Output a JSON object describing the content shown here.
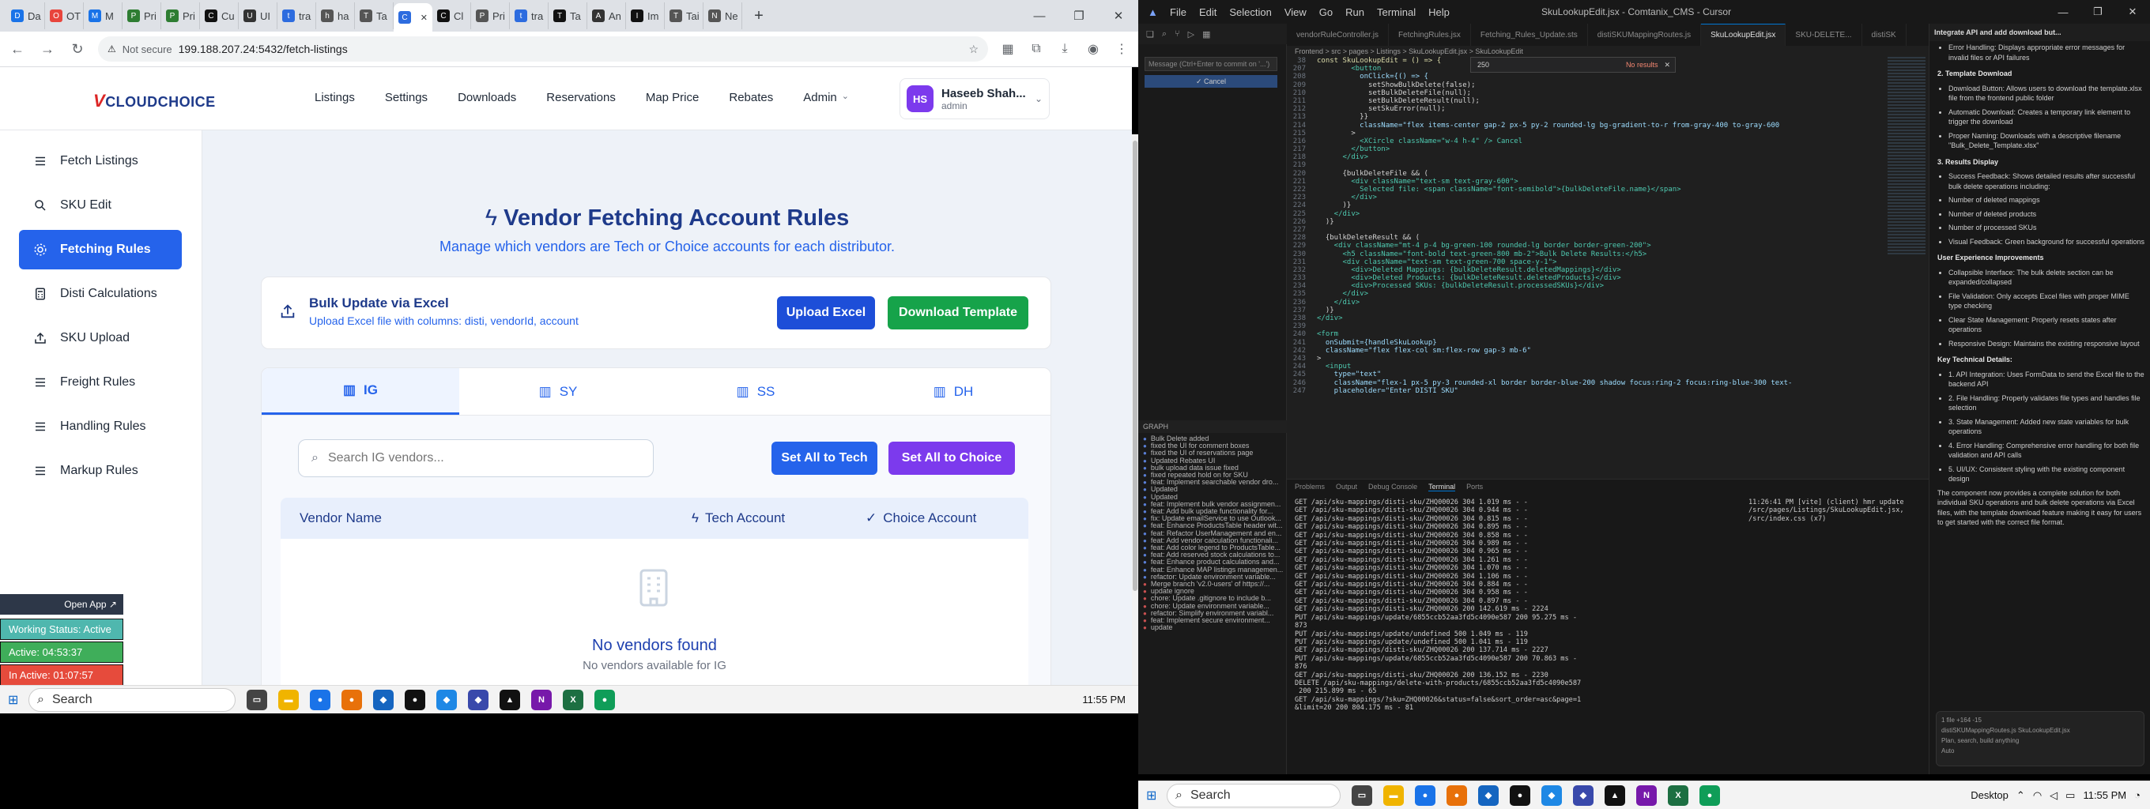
{
  "browser": {
    "tabs": [
      {
        "label": "Da",
        "color": "#1a73e8",
        "icon": "D"
      },
      {
        "label": "OT",
        "color": "#e8453c",
        "icon": "O"
      },
      {
        "label": "M",
        "color": "#1a73e8",
        "icon": "M"
      },
      {
        "label": "Pri",
        "color": "#2e7d32",
        "icon": "P"
      },
      {
        "label": "Pri",
        "color": "#2e7d32",
        "icon": "P"
      },
      {
        "label": "Cu",
        "color": "#111111",
        "icon": "C"
      },
      {
        "label": "UI",
        "color": "#333333",
        "icon": "U"
      },
      {
        "label": "tra",
        "color": "#2d6cdf",
        "icon": "t"
      },
      {
        "label": "ha",
        "color": "#555555",
        "icon": "h"
      },
      {
        "label": "Ta",
        "color": "#555555",
        "icon": "T"
      },
      {
        "label": "",
        "color": "#2d6cdf",
        "icon": "C",
        "active": true
      },
      {
        "label": "Cl",
        "color": "#111111",
        "icon": "C"
      },
      {
        "label": "Pri",
        "color": "#555555",
        "icon": "P"
      },
      {
        "label": "tra",
        "color": "#2d6cdf",
        "icon": "t"
      },
      {
        "label": "Ta",
        "color": "#111111",
        "icon": "T"
      },
      {
        "label": "An",
        "color": "#333333",
        "icon": "A"
      },
      {
        "label": "Im",
        "color": "#111111",
        "icon": "I"
      },
      {
        "label": "Tai",
        "color": "#555555",
        "icon": "T"
      },
      {
        "label": "Ne",
        "color": "#555555",
        "icon": "N"
      }
    ],
    "url_security": "Not secure",
    "url": "199.188.207.24:5432/fetch-listings"
  },
  "app": {
    "logo_text": "CLOUDCHOICE",
    "logo_mark": "V",
    "nav": [
      "Listings",
      "Settings",
      "Downloads",
      "Reservations",
      "Map Price",
      "Rebates",
      "Admin"
    ],
    "user": {
      "initials": "HS",
      "name": "Haseeb Shah...",
      "role": "admin"
    },
    "sidebar": [
      {
        "label": "Fetch Listings",
        "icon": "list-icon"
      },
      {
        "label": "SKU Edit",
        "icon": "search-icon"
      },
      {
        "label": "Fetching Rules",
        "icon": "gear-icon",
        "active": true
      },
      {
        "label": "Disti Calculations",
        "icon": "calculator-icon"
      },
      {
        "label": "SKU Upload",
        "icon": "upload-icon"
      },
      {
        "label": "Freight Rules",
        "icon": "list-icon"
      },
      {
        "label": "Handling Rules",
        "icon": "list-icon"
      },
      {
        "label": "Markup Rules",
        "icon": "list-icon"
      }
    ],
    "page_title": "Vendor Fetching Account Rules",
    "page_subtitle": "Manage which vendors are Tech or Choice accounts for each distributor.",
    "bulk": {
      "title": "Bulk Update via Excel",
      "subtitle": "Upload Excel file with columns: disti, vendorId, account",
      "upload_label": "Upload Excel",
      "download_label": "Download Template"
    },
    "distributor_tabs": [
      "IG",
      "SY",
      "SS",
      "DH"
    ],
    "active_tab": "IG",
    "search_placeholder": "Search IG vendors...",
    "set_tech_label": "Set All to Tech",
    "set_choice_label": "Set All to Choice",
    "table_headers": {
      "vendor": "Vendor Name",
      "tech": "Tech Account",
      "choice": "Choice Account"
    },
    "empty_title": "No vendors found",
    "empty_subtitle": "No vendors available for IG"
  },
  "status_widget": {
    "open_app": "Open App ↗",
    "working": "Working Status: Active",
    "active": "Active: 04:53:37",
    "inactive": "In Active: 01:07:57"
  },
  "taskbar_left": {
    "search": "Search",
    "time": "11:55 PM"
  },
  "cursor_ide": {
    "menu": [
      "File",
      "Edit",
      "Selection",
      "View",
      "Go",
      "Run",
      "Terminal",
      "Help"
    ],
    "title": "SkuLookupEdit.jsx - Comtanix_CMS - Cursor",
    "editor_tabs": [
      "vendorRuleController.js",
      "FetchingRules.jsx",
      "Fetching_Rules_Update.sts",
      "distiSKUMappingRoutes.js",
      "SkuLookupEdit.jsx",
      "SKU-DELETE...",
      "distiSK"
    ],
    "active_editor_tab": "SkuLookupEdit.jsx",
    "breadcrumb": "Frontend > src > pages > Listings > SkuLookupEdit.jsx > SkuLookupEdit",
    "find_value": "250",
    "find_result": "No results",
    "commit_placeholder": "Message (Ctrl+Enter to commit on '...')",
    "commit_button": "✓ Cancel",
    "graph_header": "GRAPH",
    "graph_lines": [
      "Bulk Delete added",
      "fixed the UI for comment boxes",
      "fixed the UI of reservations page",
      "Updated Rebates UI",
      "bulk upload data issue fixed",
      "fixed repeated hold on for SKU",
      "feat: Implement searchable vendor dro...",
      "Updated",
      "Updated",
      "feat: Implement bulk vendor assignmen...",
      "feat: Add bulk update functionality for...",
      "fix: Update emailService to use Outlook...",
      "feat: Enhance ProductsTable header wit...",
      "feat: Refactor UserManagement and en...",
      "feat: Add vendor calculation functionali...",
      "feat: Add color legend to ProductsTable...",
      "feat: Add reserved stock calculations to...",
      "feat: Enhance product calculations and...",
      "feat: Enhance MAP listings managemen...",
      "refactor: Update environment variable...",
      "Merge branch 'v2.0-users' of https://...",
      "update ignore",
      "chore: Update .gitignore to include b...",
      "chore: Update environment variable...",
      "refactor: Simplify environment variabl...",
      "feat: Implement secure environment...",
      "update"
    ],
    "code_lines": [
      {
        "n": "38",
        "t": "const SkuLookupEdit = () => {"
      },
      {
        "n": "207",
        "t": "        <button"
      },
      {
        "n": "208",
        "t": "          onClick={() => {"
      },
      {
        "n": "209",
        "t": "            setShowBulkDelete(false);"
      },
      {
        "n": "210",
        "t": "            setBulkDeleteFile(null);"
      },
      {
        "n": "211",
        "t": "            setBulkDeleteResult(null);"
      },
      {
        "n": "212",
        "t": "            setSkuError(null);"
      },
      {
        "n": "213",
        "t": "          }}"
      },
      {
        "n": "214",
        "t": "          className=\"flex items-center gap-2 px-5 py-2 rounded-lg bg-gradient-to-r from-gray-400 to-gray-600"
      },
      {
        "n": "215",
        "t": "        >"
      },
      {
        "n": "216",
        "t": "          <XCircle className=\"w-4 h-4\" /> Cancel"
      },
      {
        "n": "217",
        "t": "        </button>"
      },
      {
        "n": "218",
        "t": "      </div>"
      },
      {
        "n": "219",
        "t": ""
      },
      {
        "n": "220",
        "t": "      {bulkDeleteFile && ("
      },
      {
        "n": "221",
        "t": "        <div className=\"text-sm text-gray-600\">"
      },
      {
        "n": "222",
        "t": "          Selected file: <span className=\"font-semibold\">{bulkDeleteFile.name}</span>"
      },
      {
        "n": "223",
        "t": "        </div>"
      },
      {
        "n": "224",
        "t": "      )}"
      },
      {
        "n": "225",
        "t": "    </div>"
      },
      {
        "n": "226",
        "t": "  )}"
      },
      {
        "n": "227",
        "t": ""
      },
      {
        "n": "228",
        "t": "  {bulkDeleteResult && ("
      },
      {
        "n": "229",
        "t": "    <div className=\"mt-4 p-4 bg-green-100 rounded-lg border border-green-200\">"
      },
      {
        "n": "230",
        "t": "      <h5 className=\"font-bold text-green-800 mb-2\">Bulk Delete Results:</h5>"
      },
      {
        "n": "231",
        "t": "      <div className=\"text-sm text-green-700 space-y-1\">"
      },
      {
        "n": "232",
        "t": "        <div>Deleted Mappings: {bulkDeleteResult.deletedMappings}</div>"
      },
      {
        "n": "233",
        "t": "        <div>Deleted Products: {bulkDeleteResult.deletedProducts}</div>"
      },
      {
        "n": "234",
        "t": "        <div>Processed SKUs: {bulkDeleteResult.processedSKUs}</div>"
      },
      {
        "n": "235",
        "t": "      </div>"
      },
      {
        "n": "236",
        "t": "    </div>"
      },
      {
        "n": "237",
        "t": "  )}"
      },
      {
        "n": "238",
        "t": "</div>"
      },
      {
        "n": "239",
        "t": ""
      },
      {
        "n": "240",
        "t": "<form"
      },
      {
        "n": "241",
        "t": "  onSubmit={handleSkuLookup}"
      },
      {
        "n": "242",
        "t": "  className=\"flex flex-col sm:flex-row gap-3 mb-6\""
      },
      {
        "n": "243",
        "t": ">"
      },
      {
        "n": "244",
        "t": "  <input"
      },
      {
        "n": "245",
        "t": "    type=\"text\""
      },
      {
        "n": "246",
        "t": "    className=\"flex-1 px-5 py-3 rounded-xl border border-blue-200 shadow focus:ring-2 focus:ring-blue-300 text-"
      },
      {
        "n": "247",
        "t": "    placeholder=\"Enter DISTI SKU\""
      }
    ],
    "terminal_tabs": [
      "Problems",
      "Output",
      "Debug Console",
      "Terminal",
      "Ports"
    ],
    "terminal_lines": [
      "GET /api/sku-mappings/disti-sku/ZHQ00026 304 1.019 ms - -",
      "GET /api/sku-mappings/disti-sku/ZHQ00026 304 0.944 ms - -",
      "GET /api/sku-mappings/disti-sku/ZHQ00026 304 0.815 ms - -",
      "GET /api/sku-mappings/disti-sku/ZHQ00026 304 0.895 ms - -",
      "GET /api/sku-mappings/disti-sku/ZHQ00026 304 0.858 ms - -",
      "GET /api/sku-mappings/disti-sku/ZHQ00026 304 0.989 ms - -",
      "GET /api/sku-mappings/disti-sku/ZHQ00026 304 0.965 ms - -",
      "GET /api/sku-mappings/disti-sku/ZHQ00026 304 1.261 ms - -",
      "GET /api/sku-mappings/disti-sku/ZHQ00026 304 1.070 ms - -",
      "GET /api/sku-mappings/disti-sku/ZHQ00026 304 1.106 ms - -",
      "GET /api/sku-mappings/disti-sku/ZHQ00026 304 0.884 ms - -",
      "GET /api/sku-mappings/disti-sku/ZHQ00026 304 0.958 ms - -",
      "GET /api/sku-mappings/disti-sku/ZHQ00026 304 0.897 ms - -",
      "GET /api/sku-mappings/disti-sku/ZHQ00026 200 142.619 ms - 2224",
      "PUT /api/sku-mappings/update/6855ccb52aa3fd5c4090e587 200 95.275 ms -",
      "873",
      "PUT /api/sku-mappings/update/undefined 500 1.049 ms - 119",
      "PUT /api/sku-mappings/update/undefined 500 1.041 ms - 119",
      "GET /api/sku-mappings/disti-sku/ZHQ00026 200 137.714 ms - 2227",
      "PUT /api/sku-mappings/update/6855ccb52aa3fd5c4090e587 200 70.863 ms -",
      "876",
      "GET /api/sku-mappings/disti-sku/ZHQ00026 200 136.152 ms - 2230",
      "DELETE /api/sku-mappings/delete-with-products/6855ccb52aa3fd5c4090e587",
      " 200 215.899 ms - 65",
      "GET /api/sku-mappings/?sku=ZHQ00026&status=false&sort_order=asc&page=1",
      "&limit=20 200 804.175 ms - 81"
    ],
    "terminal_side": "11:26:41 PM [vite] (client) hmr update /src/pages/Listings/SkuLookupEdit.jsx, /src/index.css (x7)",
    "chat_header": "Integrate API and add download but...",
    "chat_blocks": [
      {
        "type": "li",
        "text": "Error Handling: Displays appropriate error messages for invalid files or API failures"
      },
      {
        "type": "h",
        "text": "2. Template Download"
      },
      {
        "type": "li",
        "text": "Download Button: Allows users to download the template.xlsx file from the frontend public folder"
      },
      {
        "type": "li",
        "text": "Automatic Download: Creates a temporary link element to trigger the download"
      },
      {
        "type": "li",
        "text": "Proper Naming: Downloads with a descriptive filename \"Bulk_Delete_Template.xlsx\""
      },
      {
        "type": "h",
        "text": "3. Results Display"
      },
      {
        "type": "li",
        "text": "Success Feedback: Shows detailed results after successful bulk delete operations including:"
      },
      {
        "type": "li",
        "text": "Number of deleted mappings"
      },
      {
        "type": "li",
        "text": "Number of deleted products"
      },
      {
        "type": "li",
        "text": "Number of processed SKUs"
      },
      {
        "type": "li",
        "text": "Visual Feedback: Green background for successful operations"
      },
      {
        "type": "h",
        "text": "User Experience Improvements"
      },
      {
        "type": "li",
        "text": "Collapsible Interface: The bulk delete section can be expanded/collapsed"
      },
      {
        "type": "li",
        "text": "File Validation: Only accepts Excel files with proper MIME type checking"
      },
      {
        "type": "li",
        "text": "Clear State Management: Properly resets states after operations"
      },
      {
        "type": "li",
        "text": "Responsive Design: Maintains the existing responsive layout"
      },
      {
        "type": "h",
        "text": "Key Technical Details:"
      },
      {
        "type": "li",
        "text": "1. API Integration: Uses FormData to send the Excel file to the backend API"
      },
      {
        "type": "li",
        "text": "2. File Handling: Properly validates file types and handles file selection"
      },
      {
        "type": "li",
        "text": "3. State Management: Added new state variables for bulk operations"
      },
      {
        "type": "li",
        "text": "4. Error Handling: Comprehensive error handling for both file validation and API calls"
      },
      {
        "type": "li",
        "text": "5. UI/UX: Consistent styling with the existing component design"
      },
      {
        "type": "p",
        "text": "The component now provides a complete solution for both individual SKU operations and bulk delete operations via Excel files, with the template download feature making it easy for users to get started with the correct file format."
      }
    ],
    "chat_input_lines": [
      "1 file +164 -15",
      "distiSKUMappingRoutes.js   SkuLookupEdit.jsx",
      "Plan, search, build anything",
      "Auto"
    ]
  },
  "taskbar_right": {
    "search": "Search",
    "desktop": "Desktop",
    "time": "11:55 PM"
  }
}
